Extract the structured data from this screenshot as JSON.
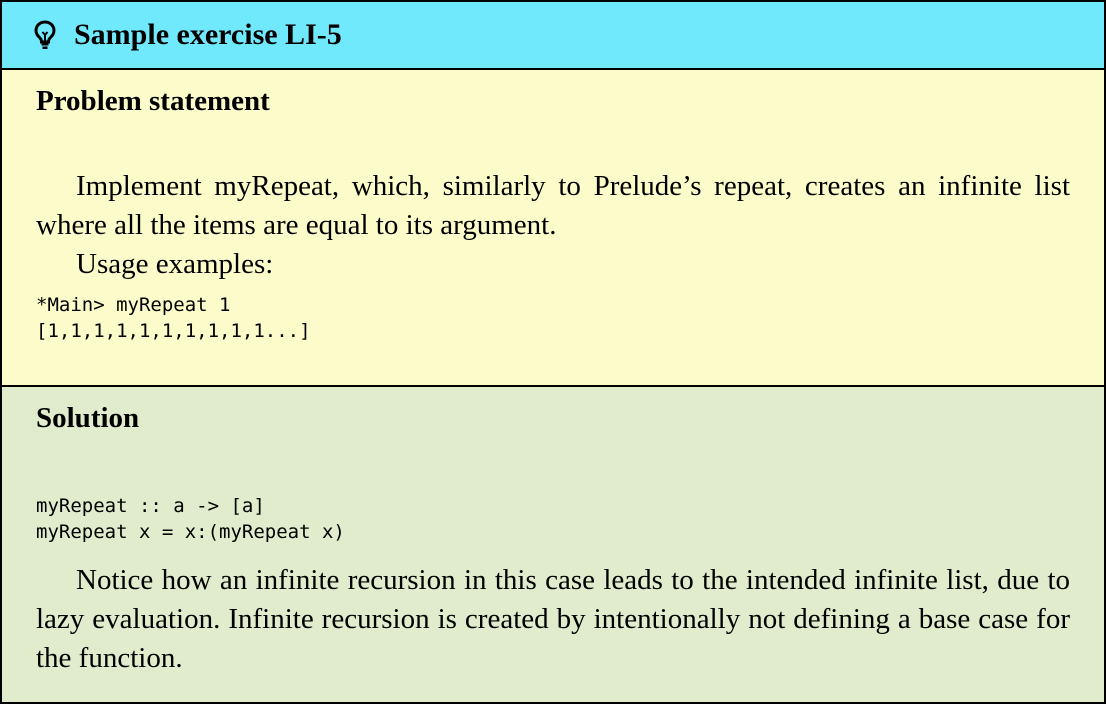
{
  "header": {
    "icon": "lightbulb-icon",
    "title": "Sample exercise LI-5",
    "color": "#6fe9fb"
  },
  "problem": {
    "title": "Problem statement",
    "paragraph": "Implement myRepeat, which, similarly to Prelude’s repeat, creates an infinite list where all the items are equal to its argument.",
    "usage_label": "Usage examples:",
    "code": [
      "*Main> myRepeat 1",
      "[1,1,1,1,1,1,1,1,1,1...]"
    ],
    "color": "#fcfccb"
  },
  "solution": {
    "title": "Solution",
    "code": [
      "myRepeat :: a -> [a]",
      "myRepeat x = x:(myRepeat x)"
    ],
    "paragraph": "Notice how an infinite recursion in this case leads to the intended infinite list, due to lazy evaluation. Infinite recursion is created by intentionally not defining a base case for the function.",
    "color": "#e0eccb"
  }
}
